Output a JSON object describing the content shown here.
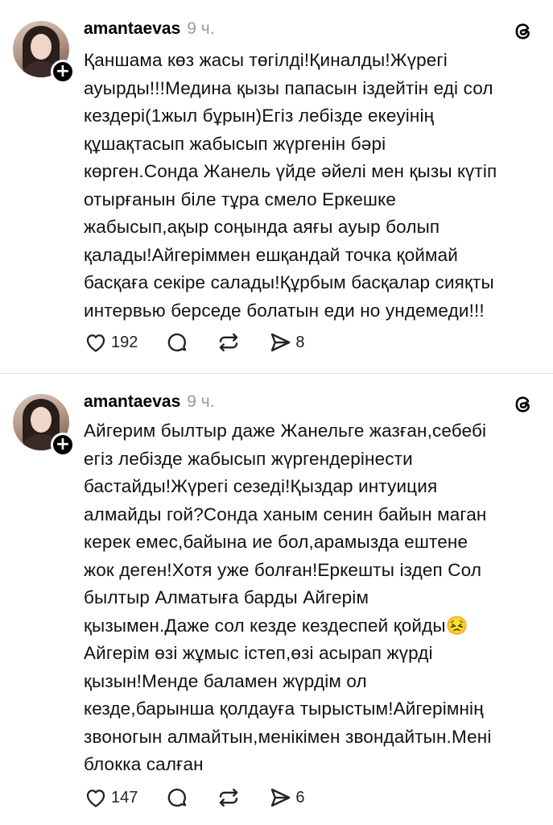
{
  "posts": [
    {
      "username": "amantaevas",
      "time": "9 ч.",
      "text": "Қаншама көз жасы төгілді!Қиналды!Жүрегі\nауырды!!!Медина қызы папасын іздейтін еді сол\nкездері(1жыл бұрын)Егіз лебізде екеуінің\nқұшақтасып жабысып жүргенін бәрі\nкөрген.Сонда Жанель үйде әйелі мен қызы күтіп\nотырғанын біле тұра смело Еркешке\nжабысып,ақыр соңында аяғы ауыр болып\nқалады!Айгеріммен ешқандай точка қоймай\nбасқаға секіре салады!Құрбым басқалар сияқты\nинтервью берседе болатын еди но ундемеди!!!",
      "likes": "192",
      "shares": "8"
    },
    {
      "username": "amantaevas",
      "time": "9 ч.",
      "text": "Айгерим былтыр даже Жанельге жазған,себебі\nегіз лебізде жабысып жүргендерінести\nбастайды!Жүрегі сезеді!Қыздар интуиция\nалмайды гой?Сонда ханым сенин байын маган\nкерек емес,байына ие бол,арамызда ештене\nжок деген!Хотя уже болған!Еркешты іздеп Сол\nбылтыр Алматыға барды Айгерім\nқызымен.Даже сол кезде кездеспей қойды😣\nАйгерім өзі жұмыс істеп,өзі асырап жүрді\nқызын!Менде баламен жүрдім ол\nкезде,барынша қолдауға тырыстым!Айгерімнің\nзвоногын алмайтын,менікімен звондайтын.Мені\nблокка салған",
      "likes": "147",
      "shares": "6"
    }
  ]
}
